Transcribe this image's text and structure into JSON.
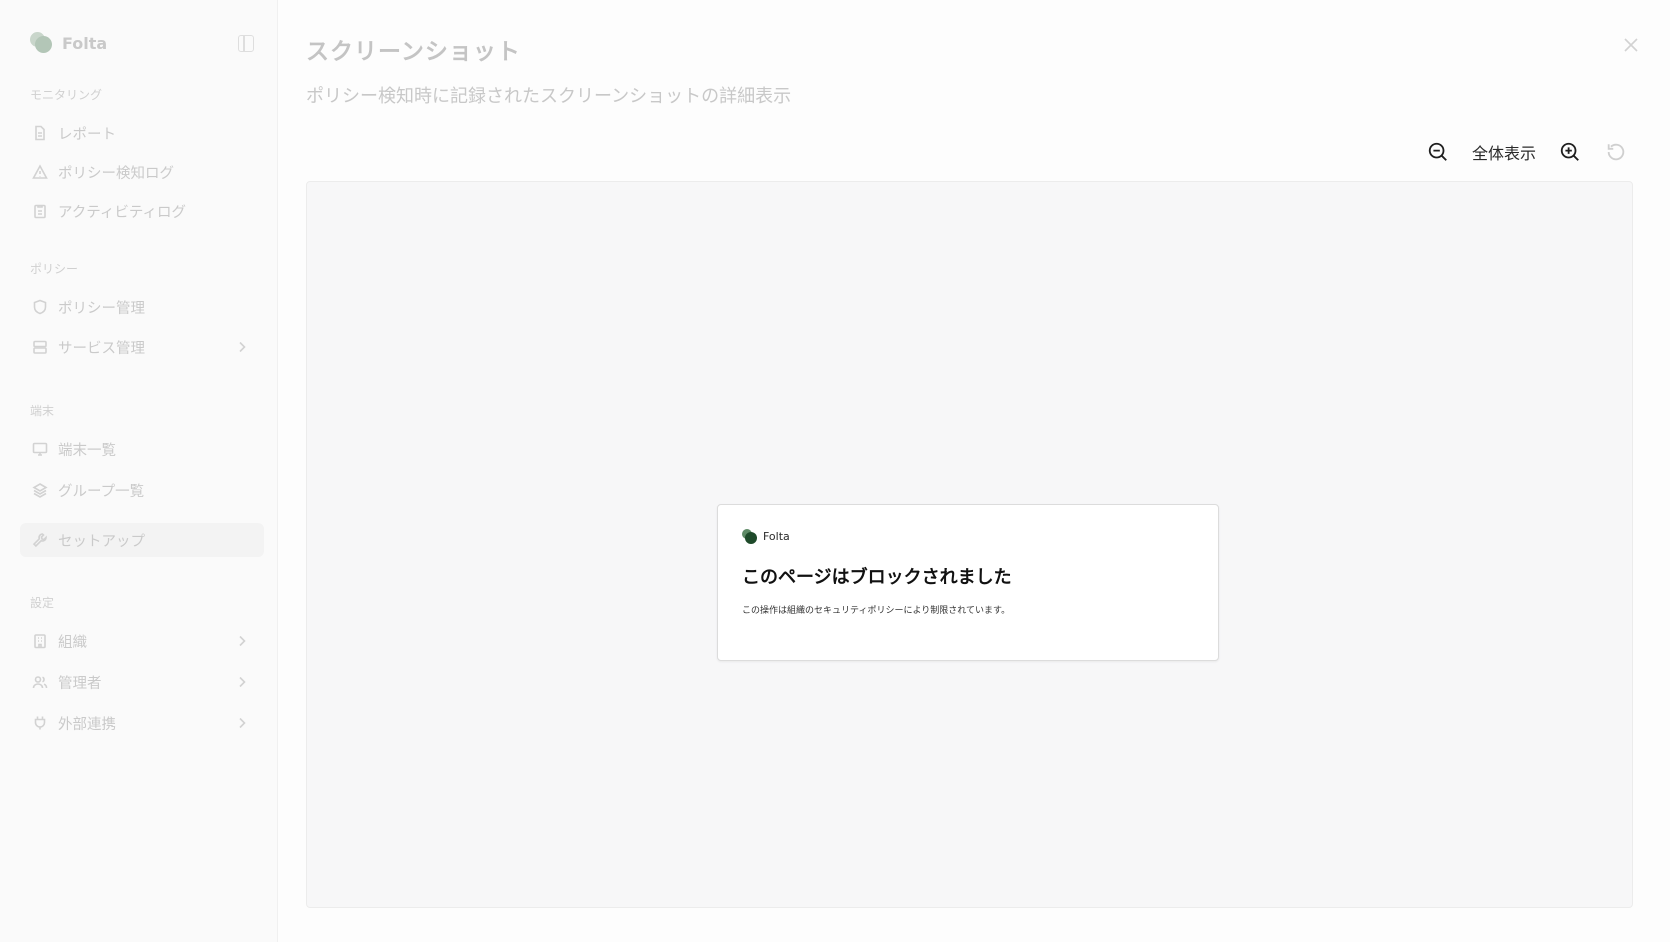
{
  "sidebar": {
    "brand": "Folta",
    "sections": {
      "monitoring": "モニタリング",
      "policy": "ポリシー",
      "device": "端末",
      "settings": "設定"
    },
    "items": [
      {
        "label": "レポート",
        "icon": "document-icon"
      },
      {
        "label": "ポリシー検知ログ",
        "icon": "warning-icon"
      },
      {
        "label": "アクティビティログ",
        "icon": "clipboard-icon"
      },
      {
        "label": "ポリシー管理",
        "icon": "shield-icon"
      },
      {
        "label": "サービス管理",
        "icon": "server-icon"
      },
      {
        "label": "端末一覧",
        "icon": "monitor-icon"
      },
      {
        "label": "グループ一覧",
        "icon": "group-icon"
      },
      {
        "label": "セットアップ",
        "icon": "wrench-icon"
      },
      {
        "label": "組織",
        "icon": "building-icon"
      },
      {
        "label": "管理者",
        "icon": "users-icon"
      },
      {
        "label": "外部連携",
        "icon": "plug-icon"
      }
    ]
  },
  "dialog": {
    "title": "スクリーンショット",
    "subtitle": "ポリシー検知時に記録されたスクリーンショットの詳細表示",
    "toolbar": {
      "fit_label": "全体表示"
    }
  },
  "screenshot": {
    "brand": "Folta",
    "heading": "このページはブロックされました",
    "message": "この操作は組織のセキュリティポリシーにより制限されています。"
  }
}
